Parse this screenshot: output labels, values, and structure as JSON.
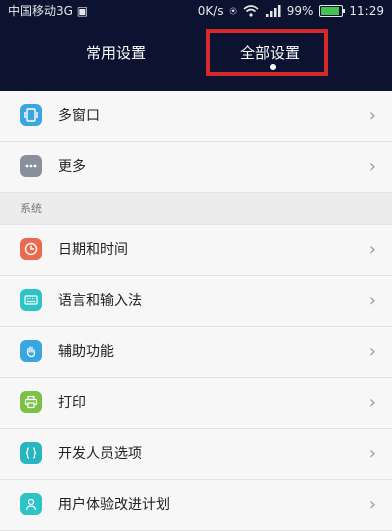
{
  "statusbar": {
    "carrier": "中国移动3G",
    "speed": "0K/s",
    "network_badge": "3G",
    "battery": "99%",
    "time": "11:29"
  },
  "tabs": {
    "common": "常用设置",
    "all": "全部设置",
    "selected": "all"
  },
  "settings": {
    "top_items": [
      {
        "label": "多窗口",
        "icon": "multi-window-icon",
        "color": "#3aa6e0"
      },
      {
        "label": "更多",
        "icon": "more-icon",
        "color": "#8a8f9c"
      }
    ],
    "section_label": "系统",
    "system_items": [
      {
        "label": "日期和时间",
        "icon": "clock-icon",
        "color": "#e96a4d"
      },
      {
        "label": "语言和输入法",
        "icon": "keyboard-icon",
        "color": "#2ec3c6"
      },
      {
        "label": "辅助功能",
        "icon": "hand-icon",
        "color": "#3aa6e0"
      },
      {
        "label": "打印",
        "icon": "printer-icon",
        "color": "#7cc146"
      },
      {
        "label": "开发人员选项",
        "icon": "code-braces-icon",
        "color": "#27b6c0"
      },
      {
        "label": "用户体验改进计划",
        "icon": "user-icon",
        "color": "#2ec3c6"
      }
    ]
  },
  "colors": {
    "header_bg": "#0b1330",
    "highlight_border": "#d62a2a"
  }
}
